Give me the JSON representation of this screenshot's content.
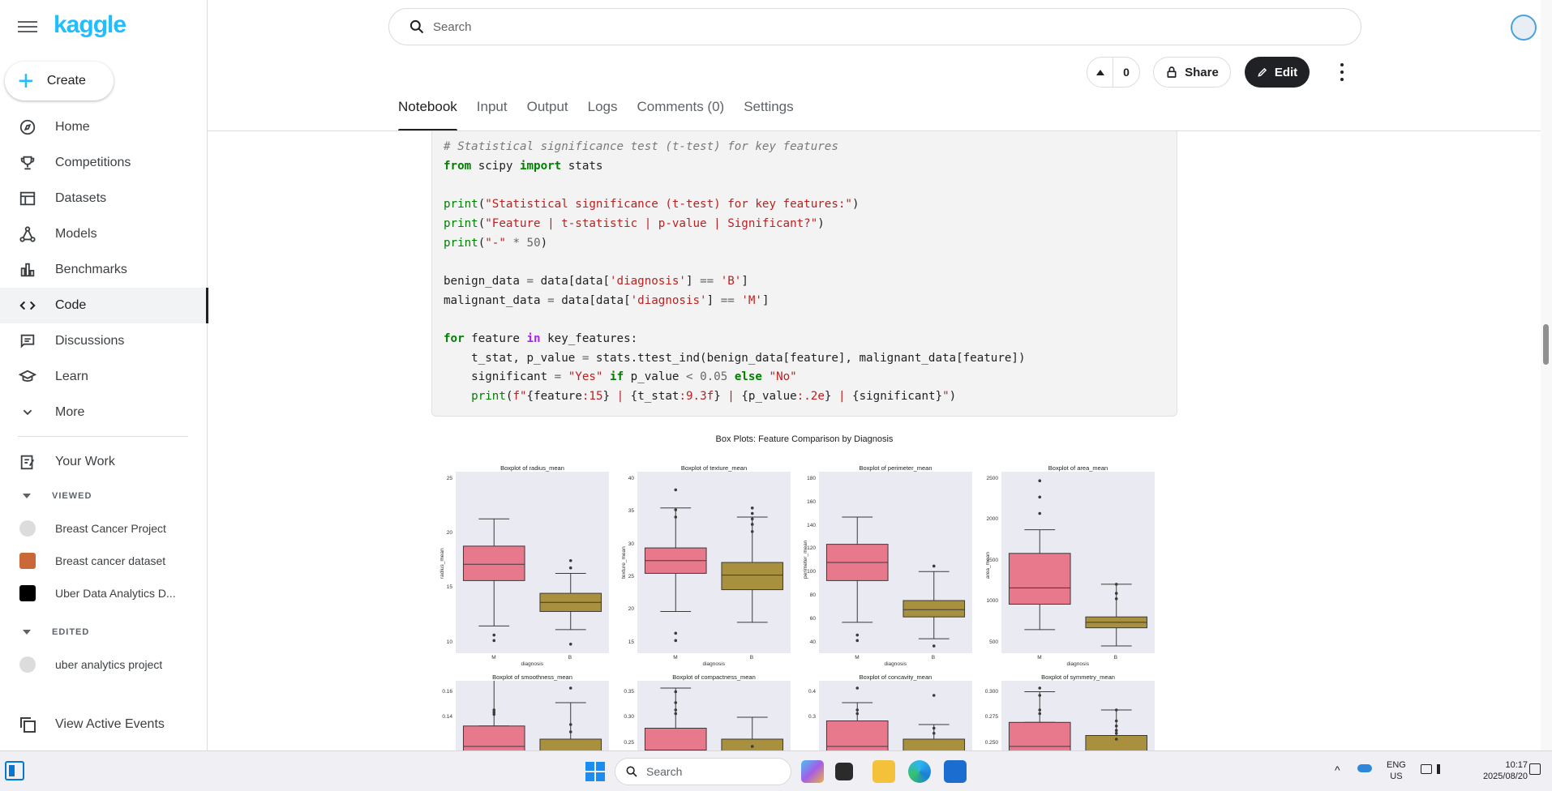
{
  "app": {
    "logo": "kaggle"
  },
  "sidebar": {
    "create_label": "Create",
    "items": [
      {
        "label": "Home",
        "icon": "compass-icon"
      },
      {
        "label": "Competitions",
        "icon": "trophy-icon"
      },
      {
        "label": "Datasets",
        "icon": "table-icon"
      },
      {
        "label": "Models",
        "icon": "models-icon"
      },
      {
        "label": "Benchmarks",
        "icon": "bar-chart-icon"
      },
      {
        "label": "Code",
        "icon": "code-icon"
      },
      {
        "label": "Discussions",
        "icon": "chat-icon"
      },
      {
        "label": "Learn",
        "icon": "school-icon"
      },
      {
        "label": "More",
        "icon": "chevron-down-icon"
      }
    ],
    "your_work": "Your Work",
    "viewed_heading": "VIEWED",
    "viewed": [
      "Breast Cancer Project",
      "Breast cancer dataset",
      "Uber Data Analytics D..."
    ],
    "edited_heading": "EDITED",
    "edited": [
      "uber analytics project"
    ],
    "view_events": "View Active Events"
  },
  "header": {
    "search_placeholder": "Search",
    "vote_count": "0",
    "share_label": "Share",
    "edit_label": "Edit"
  },
  "tabs": [
    "Notebook",
    "Input",
    "Output",
    "Logs",
    "Comments (0)",
    "Settings"
  ],
  "figure": {
    "title": "Box Plots: Feature Comparison by Diagnosis",
    "panels": [
      {
        "title": "Boxplot of radius_mean",
        "ylabel": "radius_mean",
        "xlabel": "diagnosis",
        "yticks": [
          "25",
          "20",
          "15",
          "10"
        ]
      },
      {
        "title": "Boxplot of texture_mean",
        "ylabel": "texture_mean",
        "xlabel": "diagnosis",
        "yticks": [
          "40",
          "35",
          "30",
          "25",
          "20",
          "15"
        ]
      },
      {
        "title": "Boxplot of perimeter_mean",
        "ylabel": "perimeter_mean",
        "xlabel": "diagnosis",
        "yticks": [
          "180",
          "160",
          "140",
          "120",
          "100",
          "80",
          "60",
          "40"
        ]
      },
      {
        "title": "Boxplot of area_mean",
        "ylabel": "area_mean",
        "xlabel": "diagnosis",
        "yticks": [
          "2500",
          "2000",
          "1500",
          "1000",
          "500"
        ]
      },
      {
        "title": "Boxplot of smoothness_mean",
        "yticks": [
          "0.16",
          "0.14"
        ]
      },
      {
        "title": "Boxplot of compactness_mean",
        "yticks": [
          "0.35",
          "0.30",
          "0.25"
        ]
      },
      {
        "title": "Boxplot of concavity_mean",
        "yticks": [
          "0.4",
          "0.3"
        ]
      },
      {
        "title": "Boxplot of symmetry_mean",
        "yticks": [
          "0.300",
          "0.275",
          "0.250"
        ]
      }
    ],
    "categories": [
      "M",
      "B"
    ],
    "colors": {
      "M": "#e8798d",
      "B": "#a8903e",
      "bg": "#eaeaf2"
    }
  },
  "taskbar": {
    "search_placeholder": "Search",
    "lang_top": "ENG",
    "lang_bottom": "US",
    "time": "10:17",
    "date": "2025/08/20"
  }
}
